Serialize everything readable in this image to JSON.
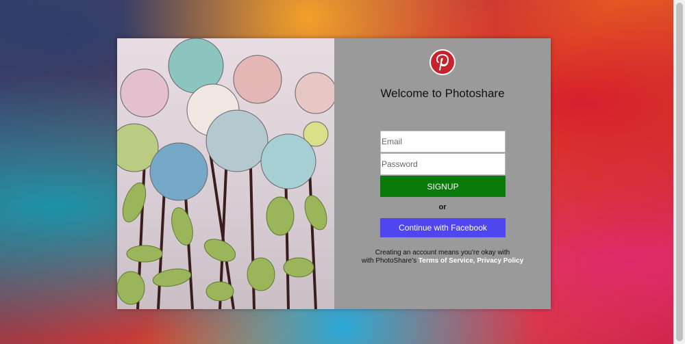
{
  "brand": {
    "logo_icon": "pinterest-icon",
    "logo_color": "#c8232c"
  },
  "welcome": {
    "title": "Welcome to Photoshare"
  },
  "form": {
    "email_placeholder": "Email",
    "password_placeholder": "Password",
    "signup_label": "SIGNUP",
    "signup_color": "#0a7a0a",
    "or_label": "or",
    "facebook_label": "Continue with Facebook",
    "facebook_color": "#5046f0"
  },
  "terms": {
    "line1": "Creating an account means you're okay with",
    "line2_prefix": "with PhotoShare's",
    "tos_link": "Terms of Service,",
    "privacy_link": "Privacy Policy"
  }
}
